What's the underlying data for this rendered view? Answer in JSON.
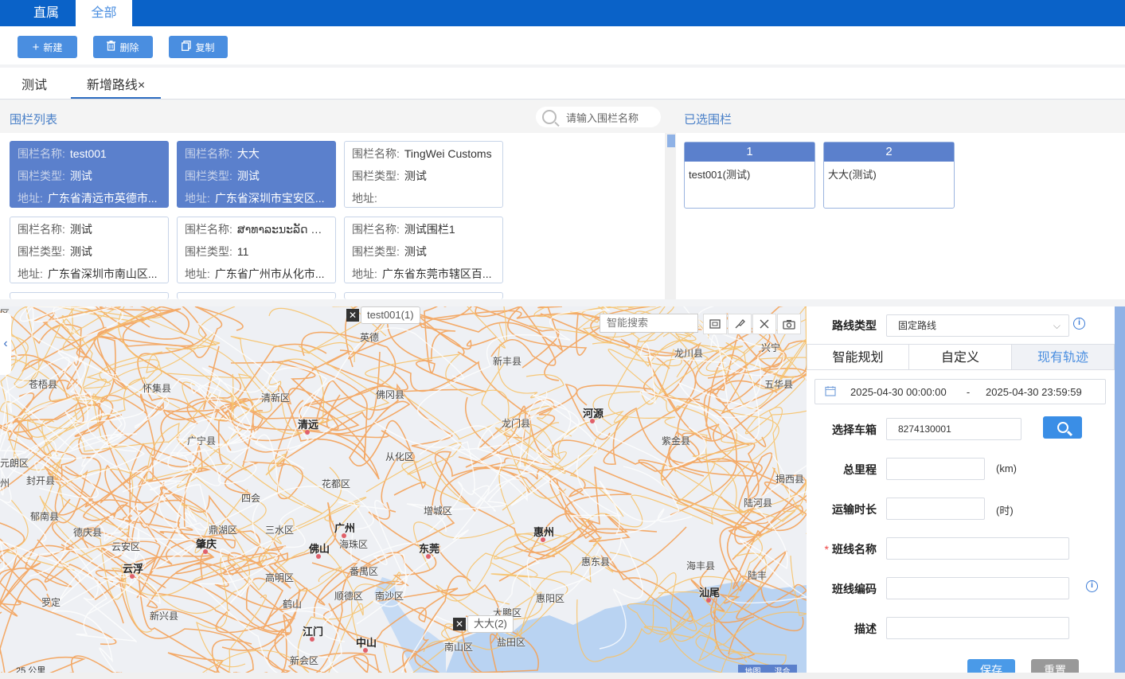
{
  "top_tabs": [
    {
      "label": "直属"
    },
    {
      "label": "全部"
    }
  ],
  "toolbar": {
    "new_label": "新建",
    "delete_label": "删除",
    "copy_label": "复制"
  },
  "route_tabs": [
    {
      "label": "测试"
    },
    {
      "label": "新增路线×"
    }
  ],
  "fence_list": {
    "title": "围栏列表",
    "search_placeholder": "请输入围栏名称",
    "labels": {
      "name": "围栏名称:",
      "type": "围栏类型:",
      "address": "地址:"
    },
    "cards": [
      {
        "name": "test001",
        "type": "测试",
        "address": "广东省清远市英德市...",
        "selected": true
      },
      {
        "name": "大大",
        "type": "测试",
        "address": "广东省深圳市宝安区...",
        "selected": true
      },
      {
        "name": "TingWei Customs",
        "type": "测试",
        "address": "",
        "selected": false
      },
      {
        "name": "测试",
        "type": "测试",
        "address": "广东省深圳市南山区...",
        "selected": false
      },
      {
        "name": "ສາທາລະນະລັດ ປະ...",
        "type": "11",
        "address": "广东省广州市从化市...",
        "selected": false
      },
      {
        "name": "测试围栏1",
        "type": "测试",
        "address": "广东省东莞市辖区百...",
        "selected": false
      }
    ]
  },
  "selected_fences": {
    "title": "已选围栏",
    "items": [
      {
        "num": "1",
        "name": "test001(测试)"
      },
      {
        "num": "2",
        "name": "大大(测试)"
      }
    ]
  },
  "map": {
    "search_placeholder": "智能搜索",
    "tool_icons": [
      "fullscreen-icon",
      "brush-icon",
      "clear-icon",
      "camera-icon"
    ],
    "markers": [
      {
        "label": "test001(1)"
      },
      {
        "label": "大大(2)"
      }
    ],
    "scale": "25 公里",
    "map_types": [
      "地图",
      "混合"
    ],
    "places": [
      "英德",
      "新丰县",
      "龙川县",
      "兴宁",
      "苍梧县",
      "怀集县",
      "清新区",
      "佛冈县",
      "五华县",
      "清远",
      "龙门县",
      "河源",
      "广宁县",
      "从化区",
      "紫金县",
      "封开县",
      "花都区",
      "揭西县",
      "四会",
      "增城区",
      "陆河县",
      "郁南县",
      "德庆县",
      "鼎湖区",
      "三水区",
      "广州",
      "惠州",
      "云安区",
      "肇庆",
      "佛山",
      "海珠区",
      "东莞",
      "惠东县",
      "云浮",
      "高明区",
      "番禺区",
      "海丰县",
      "陆丰",
      "顺德区",
      "南沙区",
      "惠阳区",
      "汕尾",
      "罗定",
      "新兴县",
      "鹤山",
      "大鹏区",
      "江门",
      "中山",
      "盐田区",
      "南山区",
      "新会区",
      "元朗区",
      "州",
      "区"
    ]
  },
  "form": {
    "route_type_label": "路线类型",
    "route_type_value": "固定路线",
    "plan_tabs": [
      {
        "label": "智能规划"
      },
      {
        "label": "自定义"
      },
      {
        "label": "现有轨迹"
      }
    ],
    "date_start": "2025-04-30 00:00:00",
    "date_sep": "-",
    "date_end": "2025-04-30 23:59:59",
    "vehicle_label": "选择车箱",
    "vehicle_value": "8274130001",
    "mileage_label": "总里程",
    "mileage_value": "",
    "mileage_unit": "(km)",
    "duration_label": "运输时长",
    "duration_value": "",
    "duration_unit": "(时)",
    "line_name_label": "班线名称",
    "line_name_value": "",
    "line_code_label": "班线编码",
    "line_code_value": "",
    "desc_label": "描述",
    "desc_value": "",
    "save_label": "保存",
    "reset_label": "重置"
  },
  "colors": {
    "primary": "#0a62c8",
    "accent": "#4a8ee0",
    "selected_card": "#5b80cc",
    "road": "#f4a35a"
  }
}
